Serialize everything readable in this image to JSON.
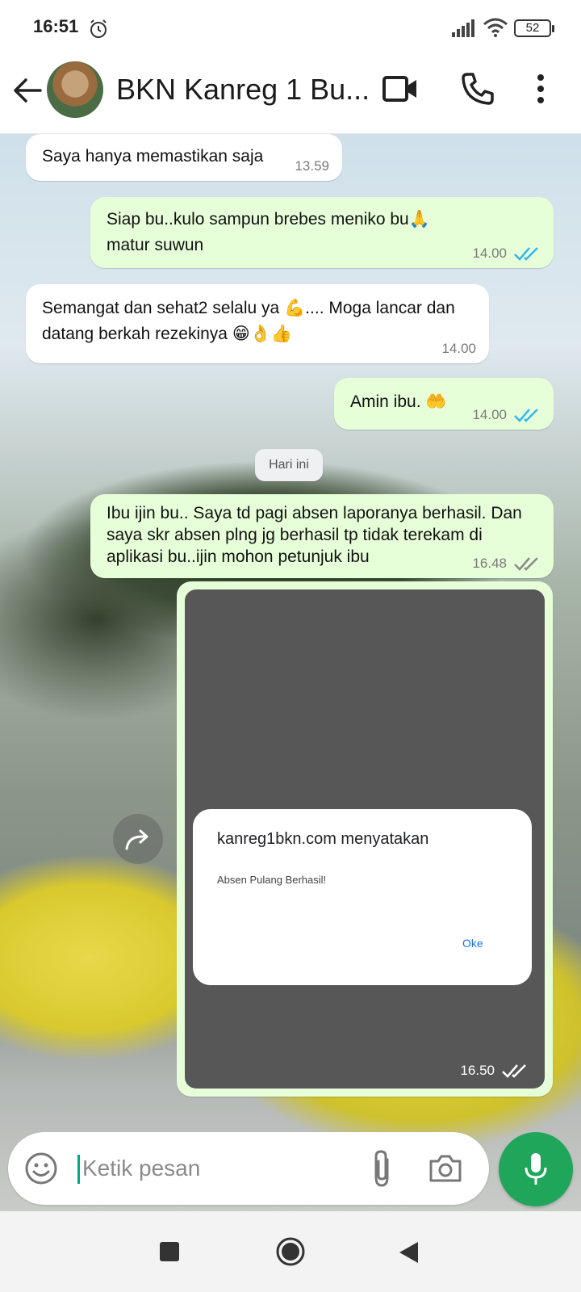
{
  "status_bar": {
    "time": "16:51",
    "battery": "52"
  },
  "header": {
    "title": "BKN Kanreg 1 Bu..."
  },
  "messages": [
    {
      "direction": "in",
      "text": "Saya hanya memastikan saja",
      "time": "13.59"
    },
    {
      "direction": "out",
      "text": "Siap bu..kulo sampun brebes meniko bu🙏 matur suwun",
      "time": "14.00",
      "read": true
    },
    {
      "direction": "in",
      "text": "Semangat dan sehat2 selalu  ya 💪.... Moga lancar dan datang berkah rezekinya 😁👌👍",
      "time": "14.00"
    },
    {
      "direction": "out",
      "text": "Amin ibu. 🤲",
      "time": "14.00",
      "read": true
    },
    {
      "direction": "out",
      "text": "Ibu ijin bu.. Saya td pagi absen laporanya berhasil. Dan saya  skr absen plng jg berhasil tp tidak terekam di aplikasi bu..ijin mohon petunjuk ibu",
      "time": "16.48",
      "read": false
    }
  ],
  "date_divider": "Hari ini",
  "image_message": {
    "time": "16.50",
    "dialog_title": "kanreg1bkn.com menyatakan",
    "dialog_message": "Absen Pulang Berhasil!",
    "dialog_button": "Oke"
  },
  "input": {
    "placeholder": "Ketik pesan"
  },
  "colors": {
    "outgoing_bubble": "#e7ffd9",
    "incoming_bubble": "#ffffff",
    "read_tick": "#34b7f1",
    "accent": "#1fa65a"
  }
}
